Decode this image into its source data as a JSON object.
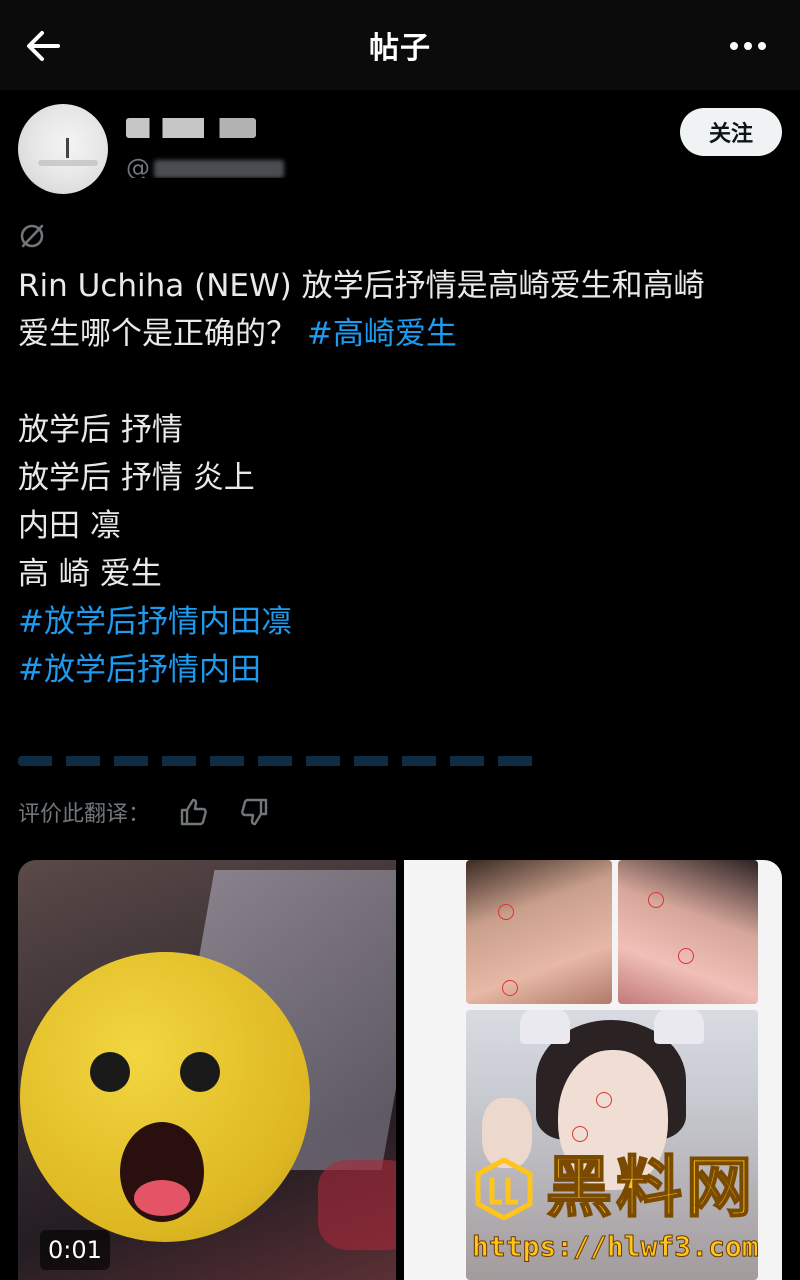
{
  "header": {
    "title": "帖子",
    "back_icon": "arrow-left-icon",
    "more_icon": "more-horizontal-icon"
  },
  "author": {
    "handle_prefix": "@",
    "follow_label": "关注"
  },
  "post": {
    "lines": [
      {
        "text": "Rin Uchiha (NEW) 放学后抒情是高崎爱生和高崎",
        "tag": ""
      },
      {
        "text": "爱生哪个是正确的？ ",
        "tag": "#高崎爱生"
      },
      {
        "text": "",
        "tag": ""
      },
      {
        "text": "放学后 抒情",
        "tag": ""
      },
      {
        "text": "放学后 抒情 炎上",
        "tag": ""
      },
      {
        "text": "内田 凛",
        "tag": ""
      },
      {
        "text": "高 崎 爱生",
        "tag": ""
      },
      {
        "text": "",
        "tag": "#放学后抒情内田凛"
      },
      {
        "text": "",
        "tag": "#放学后抒情内田"
      }
    ]
  },
  "translation": {
    "rate_label": "评价此翻译：",
    "like_icon": "thumbs-up-icon",
    "dislike_icon": "thumbs-down-icon"
  },
  "media": {
    "video_timestamp": "0:01",
    "watermark_title": "黑料网",
    "watermark_url": "https://hlwf3.com"
  },
  "colors": {
    "background": "#000000",
    "text": "#e7e9ea",
    "link": "#1d9bf0",
    "muted": "#71767b",
    "watermark": "#ffc51a"
  }
}
